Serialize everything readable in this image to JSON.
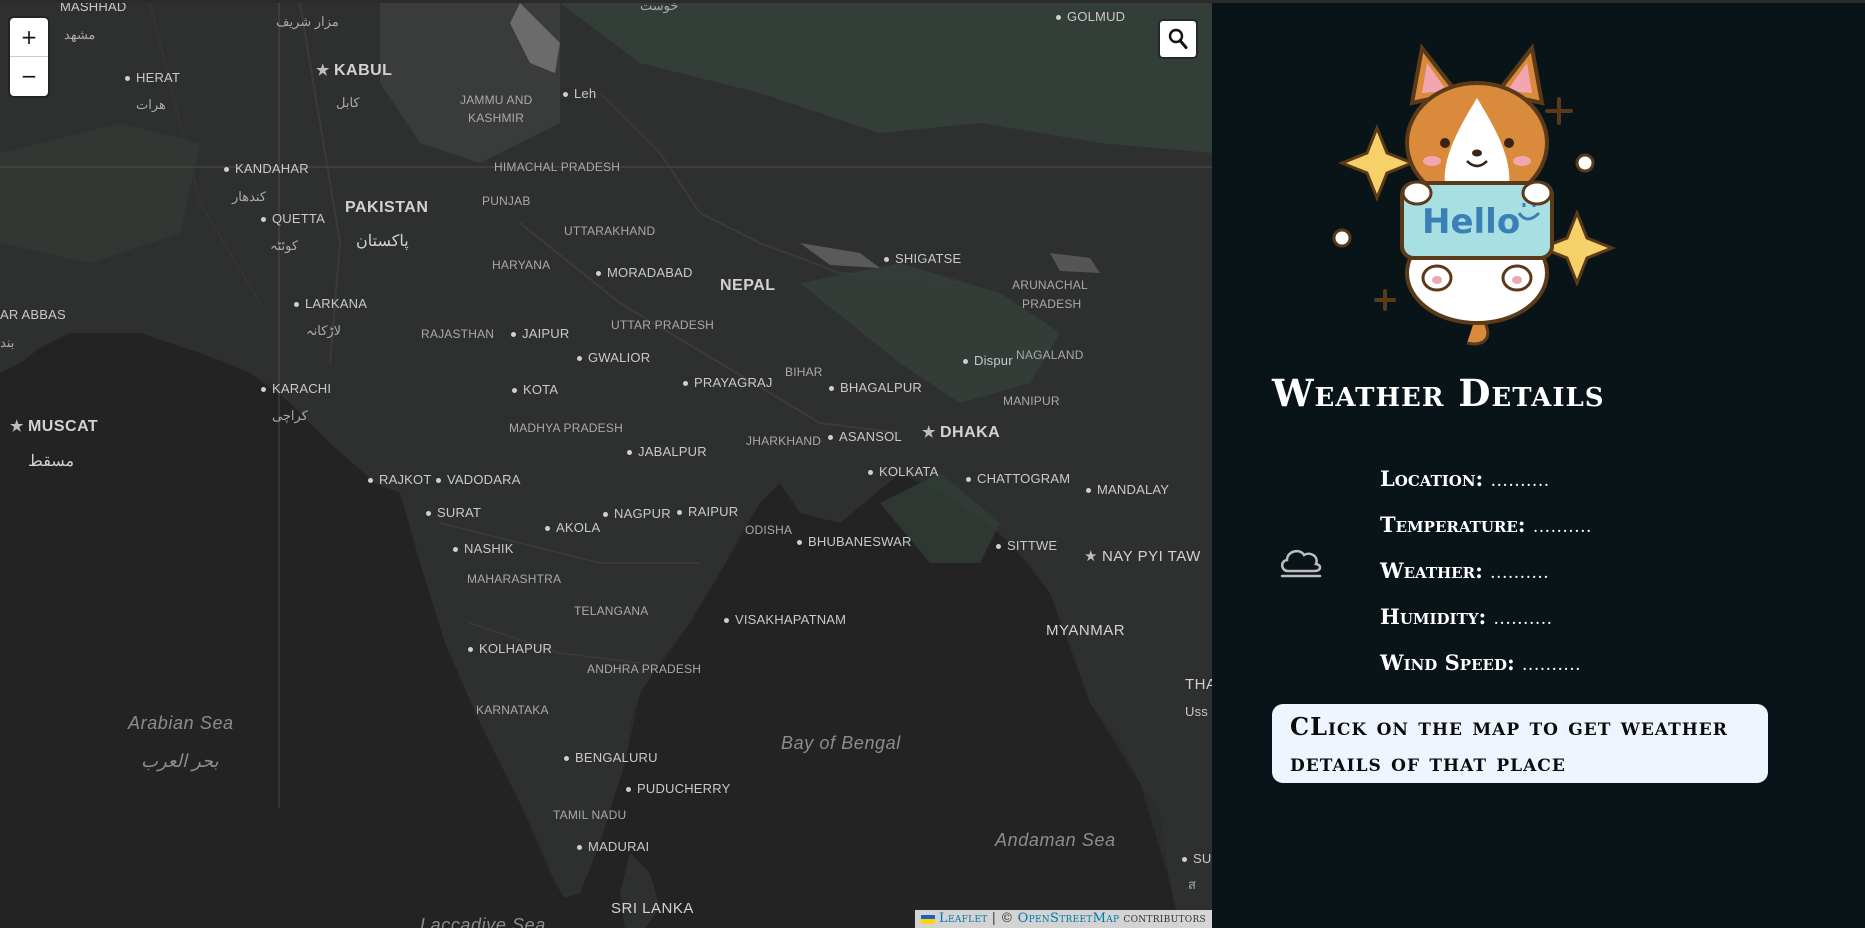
{
  "map": {
    "zoom_in": "+",
    "zoom_out": "−",
    "attribution": {
      "leaflet": "Leaflet",
      "separator": "|",
      "copyright": "©",
      "osm": "OpenStreetMap",
      "suffix": "contributors"
    },
    "labels": {
      "mashhad": "MASHHAD",
      "mashhad_ar": "مشهد",
      "mazar": "مزار شریف",
      "khost": "خوست",
      "golmud": "GOLMUD",
      "kabul": "KABUL",
      "kabul_ar": "کابل",
      "herat": "HERAT",
      "herat_ar": "هرات",
      "jammu": "JAMMU AND",
      "kashmir": "KASHMIR",
      "leh": "Leh",
      "kandahar": "KANDAHAR",
      "kandahar_ar": "کندهار",
      "himachal": "HIMACHAL PRADESH",
      "pakistan": "PAKISTAN",
      "pakistan_ar": "پاکستان",
      "punjab": "PUNJAB",
      "quetta": "QUETTA",
      "quetta_ar": "کوئٹہ",
      "uttarakhand": "UTTARAKHAND",
      "haryana": "HARYANA",
      "moradabad": "MORADABAD",
      "nepal": "NEPAL",
      "shigatse": "SHIGATSE",
      "arunachal": "ARUNACHAL",
      "pradesh": "PRADESH",
      "bandar_abbas": "AR ABBAS",
      "bandar_ar": "بند",
      "larkana": "LARKANA",
      "larkana_ar": "لاڑکانہ",
      "rajasthan": "RAJASTHAN",
      "jaipur": "JAIPUR",
      "uttar_pradesh": "UTTAR PRADESH",
      "gwalior": "GWALIOR",
      "bihar": "BIHAR",
      "dispur": "Dispur",
      "nagaland": "NAGALAND",
      "karachi": "KARACHI",
      "karachi_ar": "کراچی",
      "kota": "KOTA",
      "prayagraj": "PRAYAGRAJ",
      "bhagalpur": "BHAGALPUR",
      "manipur": "MANIPUR",
      "muscat": "MUSCAT",
      "muscat_ar": "مسقط",
      "madhya_pradesh": "MADHYA PRADESH",
      "jharkhand": "JHARKHAND",
      "asansol": "ASANSOL",
      "dhaka": "DHAKA",
      "jabalpur": "JABALPUR",
      "kolkata": "KOLKATA",
      "rajkot": "RAJKOT",
      "vadodara": "VADODARA",
      "chattogram": "CHATTOGRAM",
      "mandalay": "MANDALAY",
      "surat": "SURAT",
      "nagpur": "NAGPUR",
      "raipur": "RAIPUR",
      "akola": "AKOLA",
      "odisha": "ODISHA",
      "bhubaneswar": "BHUBANESWAR",
      "nashik": "NASHIK",
      "sittwe": "SITTWE",
      "nay_pyi_taw": "NAY PYI TAW",
      "maharashtra": "MAHARASHTRA",
      "telangana": "TELANGANA",
      "visakhapatnam": "VISAKHAPATNAM",
      "myanmar": "MYANMAR",
      "kolhapur": "KOLHAPUR",
      "andhra": "ANDHRA PRADESH",
      "tha": "THA",
      "uss": "Uss",
      "karnataka": "KARNATAKA",
      "arabian_sea": "Arabian Sea",
      "arabian_sea_ar": "بحر العرب",
      "bay_of_bengal": "Bay of Bengal",
      "bengaluru": "BENGALURU",
      "puducherry": "PUDUCHERRY",
      "tamil_nadu": "TAMIL NADU",
      "andaman_sea": "Andaman Sea",
      "madurai": "MADURAI",
      "sur": "SUR",
      "sri_lanka": "SRI LANKA",
      "laccadive": "Laccadive Sea",
      "sur_ar": "ส"
    }
  },
  "panel": {
    "title": "Weather Details",
    "fields": [
      {
        "label": "Location:",
        "value": ".........."
      },
      {
        "label": "Temperature:",
        "value": ".........."
      },
      {
        "label": "Weather:",
        "value": ".........."
      },
      {
        "label": "Humidity:",
        "value": ".........."
      },
      {
        "label": "Wind Speed:",
        "value": ".........."
      }
    ],
    "hint": "CLick on the map to get weather details of that place",
    "mascot_text": "Hello",
    "weather_icon": "cloud-icon"
  },
  "colors": {
    "panel_bg": "#091418",
    "map_bg": "#2b2c2c",
    "hint_bg": "#eef5ff"
  }
}
